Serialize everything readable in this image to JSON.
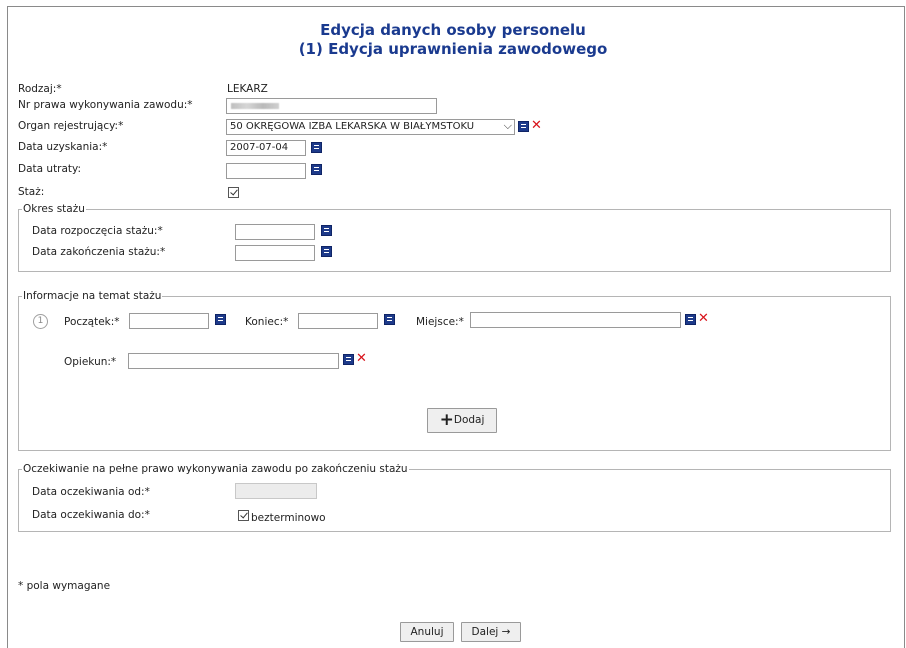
{
  "header": {
    "title_line1": "Edycja danych osoby personelu",
    "title_line2": "(1) Edycja uprawnienia zawodowego"
  },
  "form": {
    "rodzaj_label": "Rodzaj:*",
    "rodzaj_value": "LEKARZ",
    "nr_prawa_label": "Nr prawa wykonywania zawodu:*",
    "organ_label": "Organ rejestrujący:*",
    "organ_value": "50 OKRĘGOWA IZBA LEKARSKA W BIAŁYMSTOKU",
    "data_uzyskania_label": "Data uzyskania:*",
    "data_uzyskania_value": "2007-07-04",
    "data_utraty_label": "Data utraty:",
    "data_utraty_value": "",
    "staz_label": "Staż:",
    "staz_checked": true
  },
  "okres_stazu": {
    "legend": "Okres stażu",
    "rozpoczecie_label": "Data rozpoczęcia stażu:*",
    "zakonczenie_label": "Data zakończenia stażu:*"
  },
  "informacje": {
    "legend": "Informacje na temat stażu",
    "row_number": "1",
    "poczatek_label": "Początek:*",
    "koniec_label": "Koniec:*",
    "miejsce_label": "Miejsce:*",
    "opiekun_label": "Opiekun:*",
    "dodaj_label": "Dodaj"
  },
  "oczekiwanie": {
    "legend": "Oczekiwanie na pełne prawo wykonywania zawodu po zakończeniu stażu",
    "od_label": "Data oczekiwania od:*",
    "do_label": "Data oczekiwania do:*",
    "bezterminowo_label": "bezterminowo",
    "bezterminowo_checked": true
  },
  "footer": {
    "required_note": "* pola wymagane",
    "anuluj_label": "Anuluj",
    "dalej_label": "Dalej →"
  },
  "colors": {
    "title": "#1a3a8f",
    "calendar_icon": "#1d3a8a",
    "clear_icon": "#d8121a"
  }
}
